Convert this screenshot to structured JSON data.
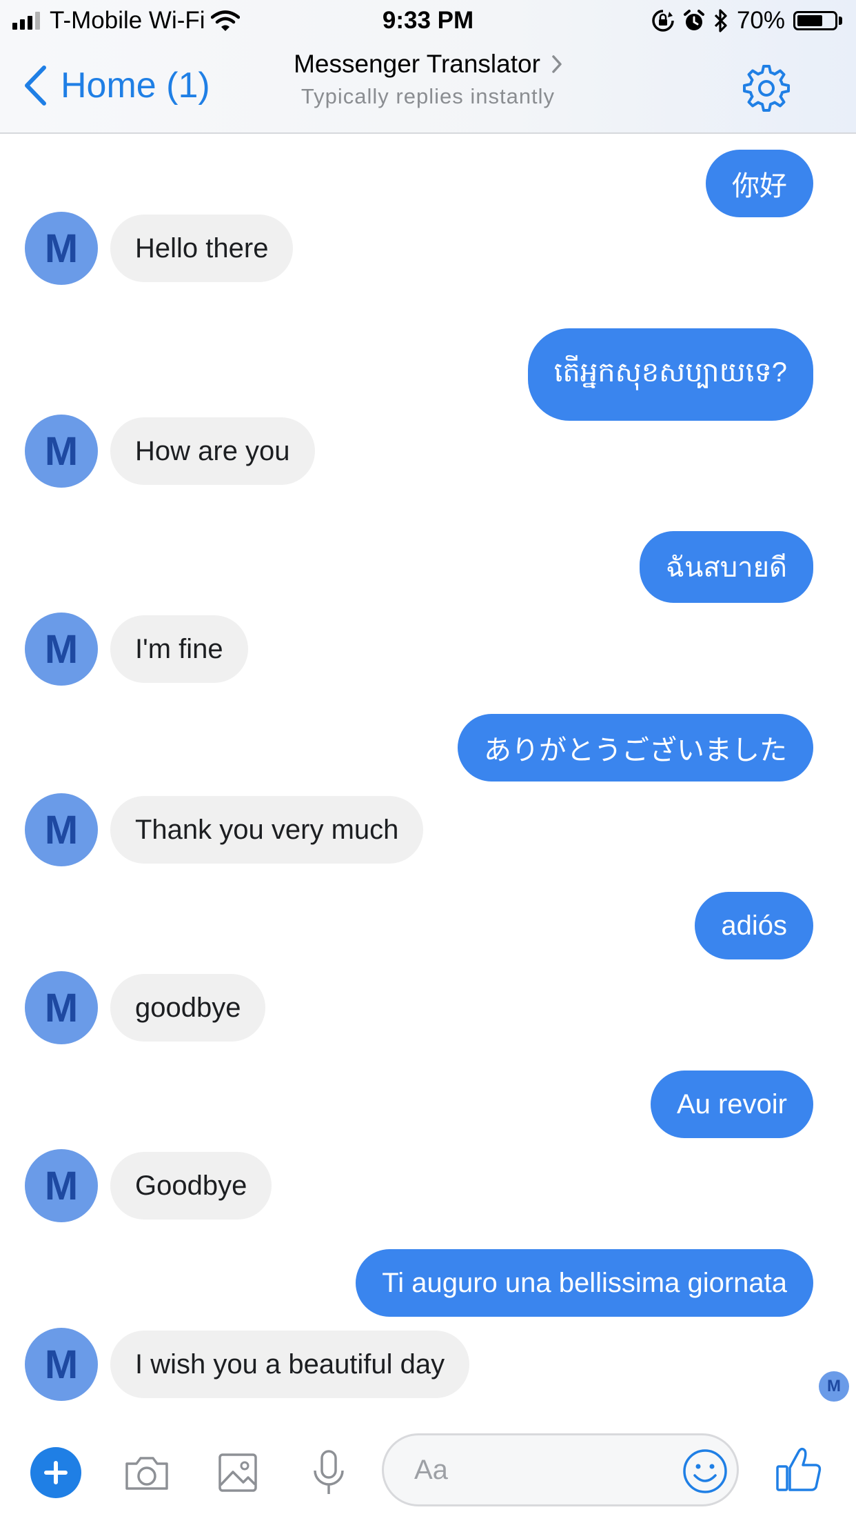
{
  "status_bar": {
    "carrier": "T-Mobile Wi-Fi",
    "time": "9:33 PM",
    "battery": "70%",
    "battery_level": 0.7,
    "icons": [
      "signal-icon",
      "wifi-icon",
      "rotation-lock-icon",
      "alarm-icon",
      "bluetooth-icon",
      "battery-icon"
    ]
  },
  "header": {
    "back_label": "Home (1)",
    "title": "Messenger Translator",
    "subtitle": "Typically replies instantly",
    "settings_icon": "gear-icon",
    "accent_color": "#1f7fe5"
  },
  "thread": {
    "avatar_letter": "M",
    "messages": [
      {
        "direction": "outgoing",
        "text": "你好"
      },
      {
        "direction": "incoming",
        "text": "Hello there"
      },
      {
        "direction": "outgoing",
        "text": "តើអ្នកសុខសប្បាយទេ?"
      },
      {
        "direction": "incoming",
        "text": "How are you"
      },
      {
        "direction": "outgoing",
        "text": "ฉันสบายดี"
      },
      {
        "direction": "incoming",
        "text": "I'm fine"
      },
      {
        "direction": "outgoing",
        "text": "ありがとうございました"
      },
      {
        "direction": "incoming",
        "text": "Thank you very much"
      },
      {
        "direction": "outgoing",
        "text": "adiós"
      },
      {
        "direction": "incoming",
        "text": "goodbye"
      },
      {
        "direction": "outgoing",
        "text": "Au revoir"
      },
      {
        "direction": "incoming",
        "text": "Goodbye"
      },
      {
        "direction": "outgoing",
        "text": "Ti auguro una bellissima giornata"
      },
      {
        "direction": "incoming",
        "text": "I wish you a beautiful day"
      }
    ],
    "seen_avatar_letter": "M",
    "outgoing_color": "#3a85ee",
    "incoming_color": "#f0f0f0"
  },
  "composer": {
    "placeholder": "Aa",
    "icons": [
      "plus-icon",
      "camera-icon",
      "image-icon",
      "microphone-icon",
      "emoji-icon",
      "thumbs-up-icon"
    ]
  }
}
